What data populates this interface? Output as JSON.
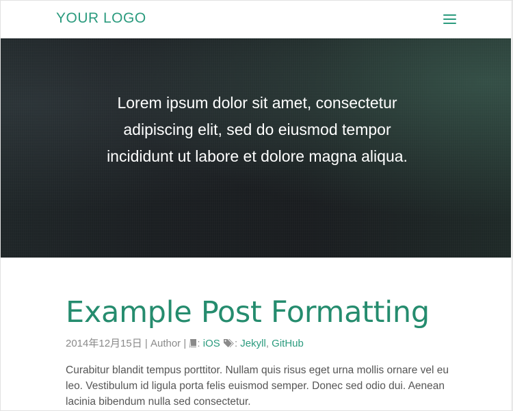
{
  "navbar": {
    "logo": "YOUR LOGO",
    "menu_icon": "hamburger-menu-icon"
  },
  "hero": {
    "text": "Lorem ipsum dolor sit amet, consectetur adipiscing elit, sed do eiusmod tempor incididunt ut labore et dolore magna aliqua."
  },
  "post": {
    "title": "Example Post Formatting",
    "meta": {
      "date": "2014年12月15日",
      "sep1": " | ",
      "author": "Author",
      "sep2": " | ",
      "category_sep": ": ",
      "category": "iOS",
      "tags_sep": ": ",
      "tags": [
        "Jekyll",
        "GitHub"
      ],
      "tag_sep": ", "
    },
    "body": "Curabitur blandit tempus porttitor. Nullam quis risus eget urna mollis ornare vel eu leo. Vestibulum id ligula porta felis euismod semper. Donec sed odio dui. Aenean lacinia bibendum nulla sed consectetur."
  },
  "colors": {
    "accent": "#2b9b7e",
    "hero_bg": "#1c2023",
    "meta_text": "#8a8a8a",
    "body_text": "#555555"
  }
}
